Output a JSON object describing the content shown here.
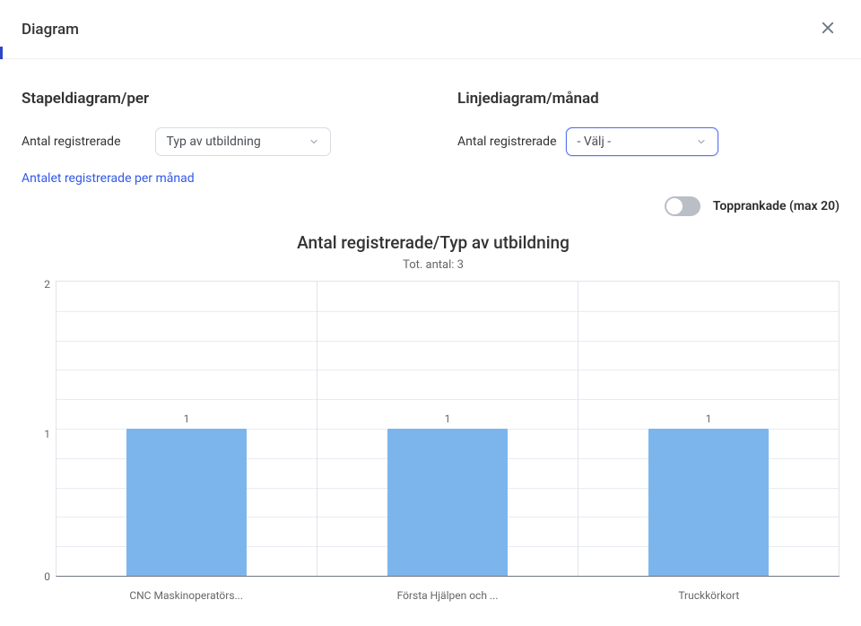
{
  "modal": {
    "title": "Diagram"
  },
  "controls": {
    "left": {
      "heading": "Stapeldiagram/per",
      "label": "Antal registrerade",
      "select_value": "Typ av utbildning",
      "link": "Antalet registrerade per månad"
    },
    "right": {
      "heading": "Linjediagram/månad",
      "label": "Antal registrerade",
      "select_value": "- Välj -"
    },
    "toggle_label": "Topprankade (max 20)"
  },
  "chart_data": {
    "type": "bar",
    "title": "Antal registrerade/Typ av utbildning",
    "subtitle": "Tot. antal: 3",
    "y_ticks": [
      "2",
      "1",
      "0"
    ],
    "ylim": [
      0,
      2
    ],
    "categories": [
      "CNC Maskinoperatörs...",
      "Första Hjälpen och ...",
      "Truckkörkort"
    ],
    "values": [
      1,
      1,
      1
    ],
    "bar_color": "#7cb5ec"
  }
}
